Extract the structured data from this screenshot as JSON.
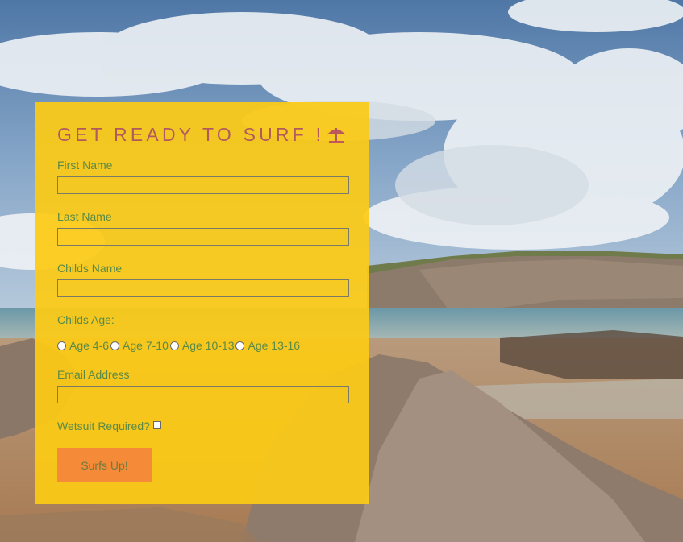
{
  "form": {
    "title": "GET READY TO SURF !",
    "first_name_label": "First Name",
    "first_name_value": "",
    "last_name_label": "Last Name",
    "last_name_value": "",
    "childs_name_label": "Childs Name",
    "childs_name_value": "",
    "childs_age_label": "Childs Age:",
    "age_options": [
      "Age 4-6",
      "Age 7-10",
      "Age 10-13",
      "Age 13-16"
    ],
    "email_label": "Email Address",
    "email_value": "",
    "wetsuit_label": "Wetsuit Required?",
    "wetsuit_checked": false,
    "submit_label": "Surfs Up!"
  },
  "colors": {
    "card": "#fcca16",
    "title": "#b05a5f",
    "label": "#5a8a46",
    "button": "#f58a38",
    "button_text": "#6d7a3e"
  },
  "icons": {
    "title_icon": "beach-umbrella-icon"
  }
}
